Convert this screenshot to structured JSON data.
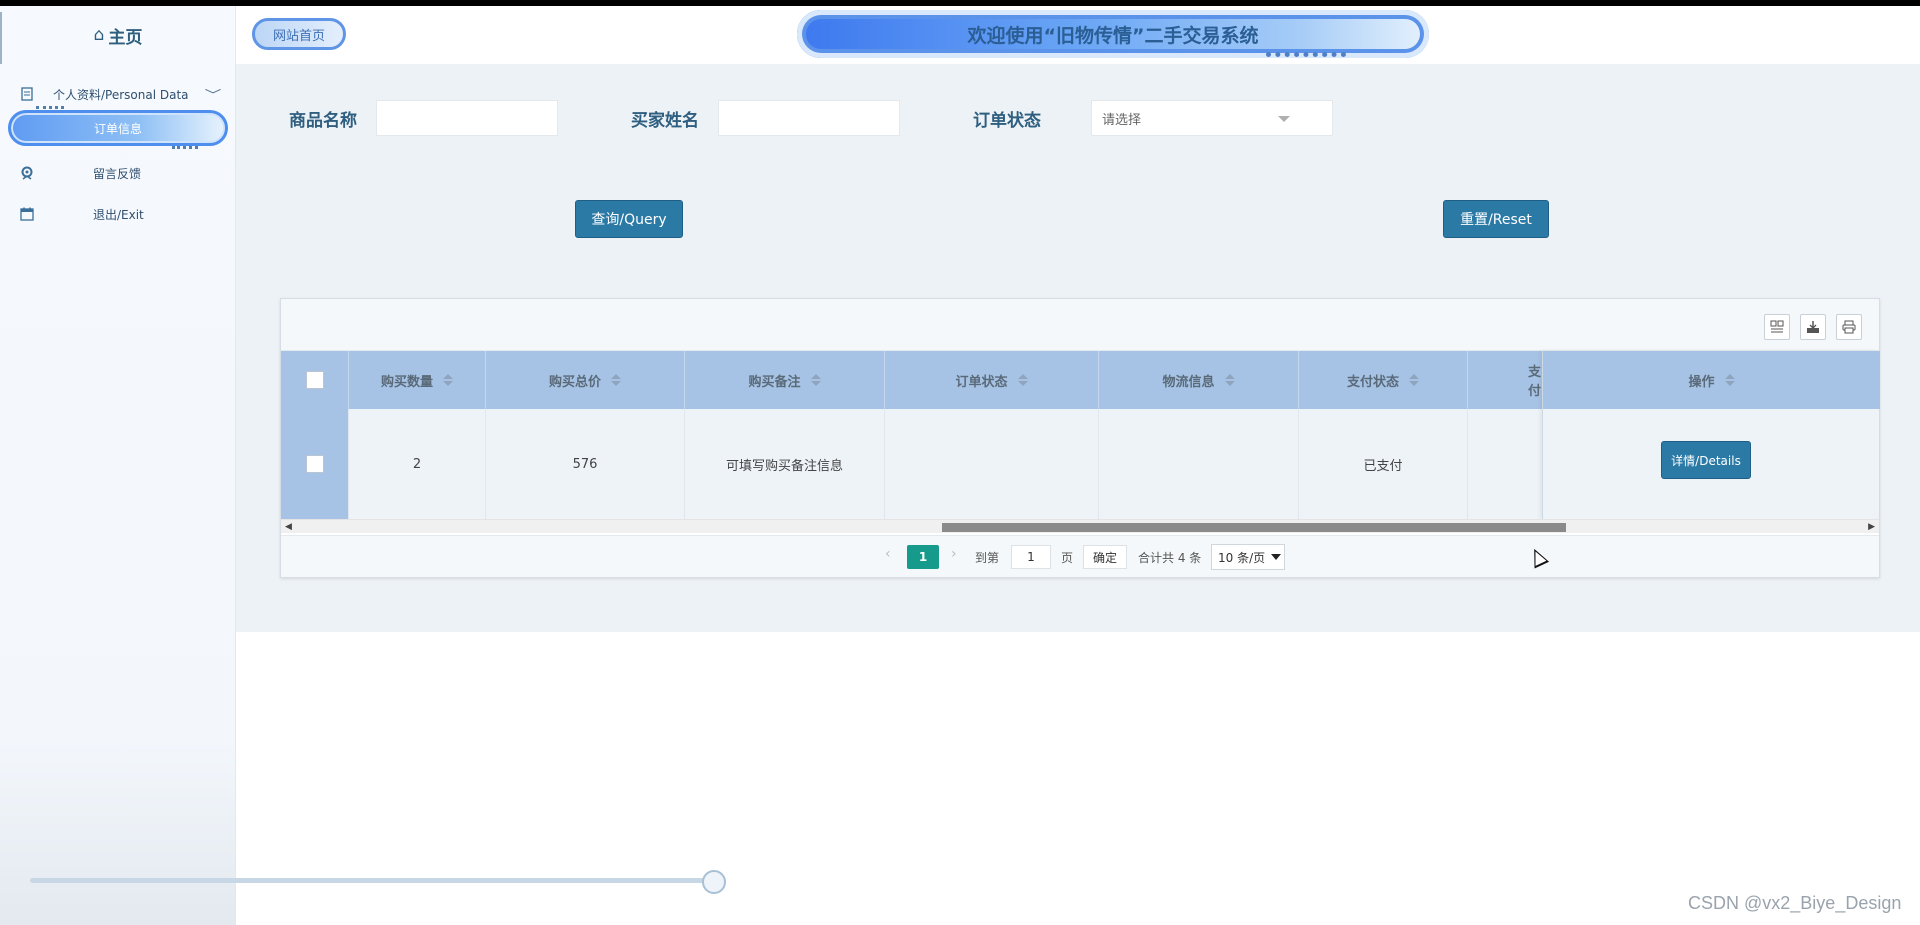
{
  "sidebar": {
    "home_label": "主页",
    "items": [
      {
        "label": "个人资料/Personal Data",
        "icon": "document-icon"
      },
      {
        "label": "订单信息",
        "icon": ""
      },
      {
        "label": "留言反馈",
        "icon": "feedback-icon"
      },
      {
        "label": "退出/Exit",
        "icon": "calendar-icon"
      }
    ]
  },
  "header": {
    "home_link": "网站首页",
    "title": "欢迎使用“旧物传情”二手交易系统"
  },
  "search": {
    "fields": [
      {
        "label": "商品名称",
        "value": ""
      },
      {
        "label": "买家姓名",
        "value": ""
      },
      {
        "label": "订单状态",
        "placeholder": "请选择"
      }
    ],
    "query_button": "查询/Query",
    "reset_button": "重置/Reset"
  },
  "table": {
    "columns": [
      "购买数量",
      "购买总价",
      "购买备注",
      "订单状态",
      "物流信息",
      "支付状态",
      "支付"
    ],
    "op_header": "操作",
    "rows": [
      {
        "购买数量": "2",
        "购买总价": "576",
        "购买备注": "可填写购买备注信息",
        "订单状态": "",
        "物流信息": "",
        "支付状态": "已支付",
        "支付": ""
      }
    ],
    "details_button": "详情/Details"
  },
  "pagination": {
    "current_page": "1",
    "goto_label": "到第",
    "goto_value": "1",
    "page_unit": "页",
    "confirm": "确定",
    "total_text": "合计共 4 条",
    "page_size": "10 条/页"
  },
  "watermark": "CSDN @vx2_Biye_Design",
  "colors": {
    "primary_button": "#2b7aa6",
    "table_header": "#a6c3e6",
    "page_active": "#159a8c",
    "title_text": "#2a5e94"
  }
}
